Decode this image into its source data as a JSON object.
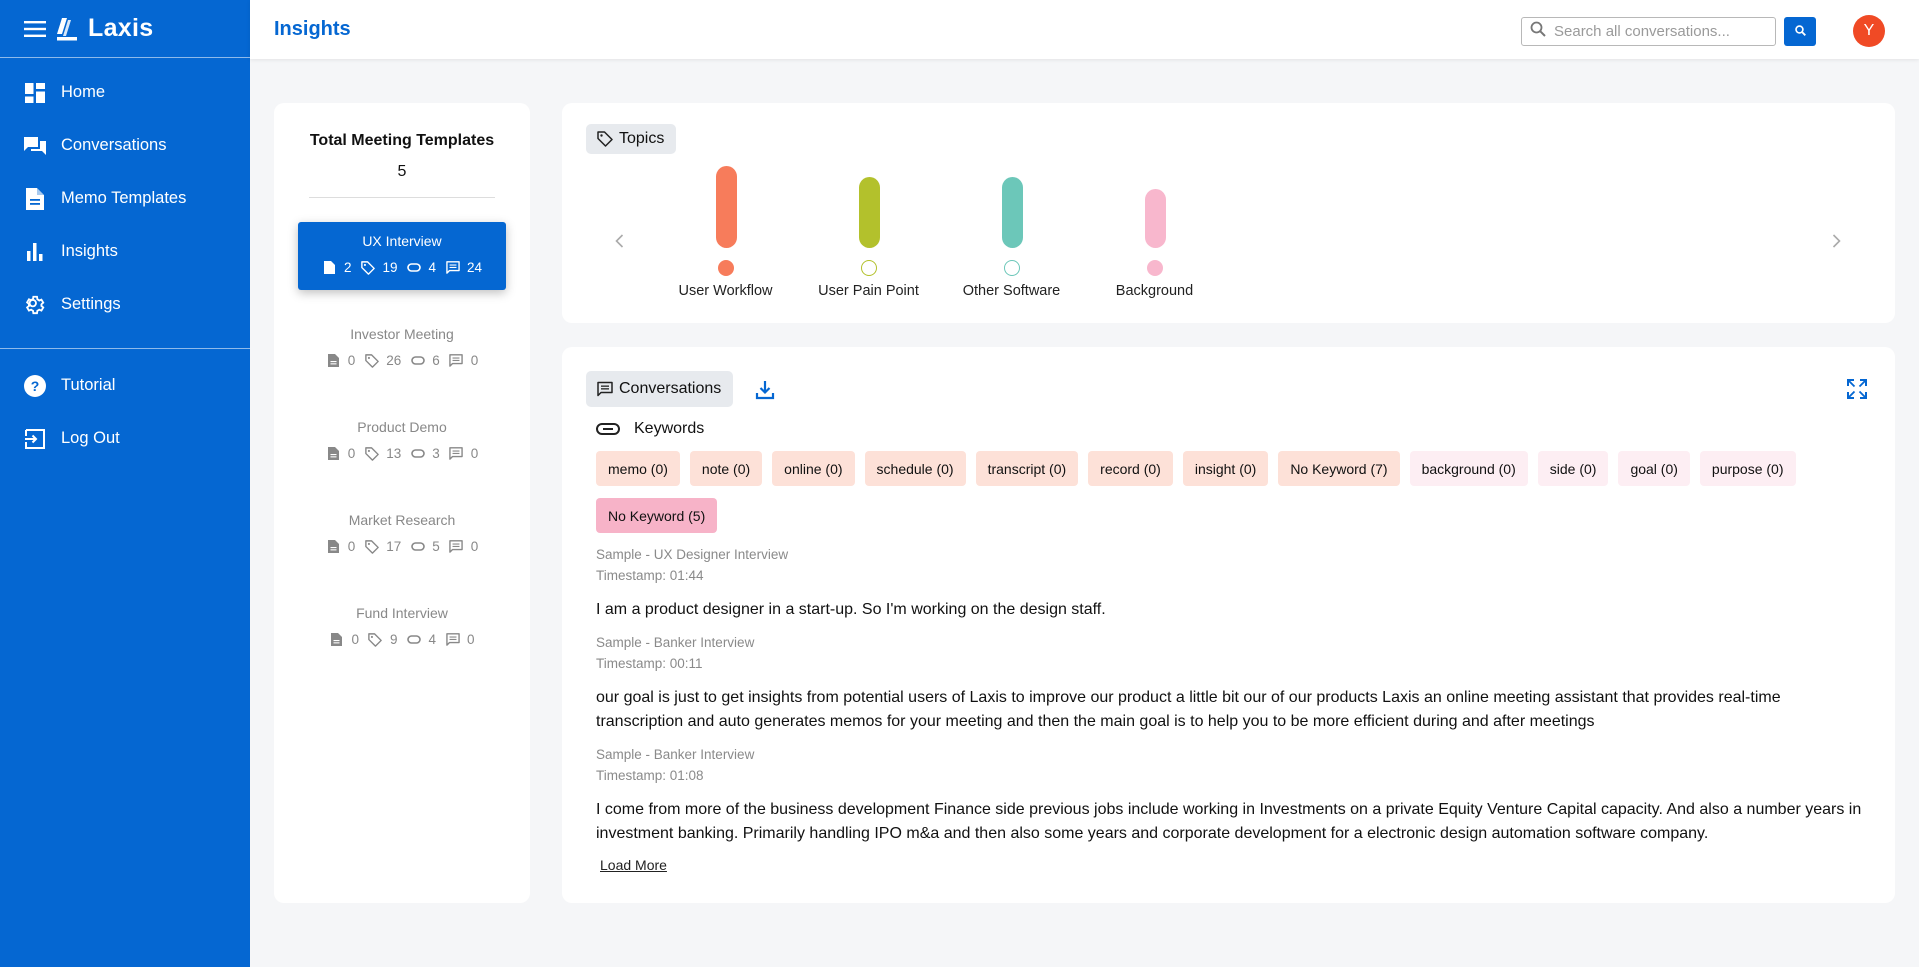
{
  "app": {
    "name": "Laxis",
    "page_title": "Insights"
  },
  "sidebar": {
    "items": [
      {
        "label": "Home",
        "icon": "dashboard-icon"
      },
      {
        "label": "Conversations",
        "icon": "chat-icon"
      },
      {
        "label": "Memo Templates",
        "icon": "document-icon"
      },
      {
        "label": "Insights",
        "icon": "bar-chart-icon"
      },
      {
        "label": "Settings",
        "icon": "gear-icon"
      }
    ],
    "bottom_items": [
      {
        "label": "Tutorial",
        "icon": "help-icon"
      },
      {
        "label": "Log Out",
        "icon": "logout-icon"
      }
    ]
  },
  "header": {
    "search_placeholder": "Search all conversations...",
    "avatar_letter": "Y"
  },
  "templates": {
    "heading": "Total Meeting Templates",
    "total": "5",
    "items": [
      {
        "name": "UX Interview",
        "memos": "2",
        "topics": "19",
        "keywords": "4",
        "conversations": "24",
        "active": true
      },
      {
        "name": "Investor Meeting",
        "memos": "0",
        "topics": "26",
        "keywords": "6",
        "conversations": "0",
        "active": false
      },
      {
        "name": "Product Demo",
        "memos": "0",
        "topics": "13",
        "keywords": "3",
        "conversations": "0",
        "active": false
      },
      {
        "name": "Market Research",
        "memos": "0",
        "topics": "17",
        "keywords": "5",
        "conversations": "0",
        "active": false
      },
      {
        "name": "Fund Interview",
        "memos": "0",
        "topics": "9",
        "keywords": "4",
        "conversations": "0",
        "active": false
      }
    ]
  },
  "topics": {
    "label": "Topics",
    "items": [
      {
        "label": "User Workflow",
        "color": "#f77c5b",
        "level": 1.0,
        "filled": true
      },
      {
        "label": "User Pain Point",
        "color": "#b3c12c",
        "level": 0.87,
        "filled": false
      },
      {
        "label": "Other Software",
        "color": "#6cc7b9",
        "level": 0.87,
        "filled": false
      },
      {
        "label": "Background",
        "color": "#f8b7cd",
        "level": 0.72,
        "filled": true
      }
    ]
  },
  "conversations": {
    "label": "Conversations",
    "keywords_label": "Keywords",
    "keywords": [
      {
        "text": "memo (0)",
        "color": "#fde1d8"
      },
      {
        "text": "note (0)",
        "color": "#fde1d8"
      },
      {
        "text": "online (0)",
        "color": "#fde1d8"
      },
      {
        "text": "schedule (0)",
        "color": "#fde1d8"
      },
      {
        "text": "transcript (0)",
        "color": "#fde1d8"
      },
      {
        "text": "record (0)",
        "color": "#fde1d8"
      },
      {
        "text": "insight (0)",
        "color": "#fde1d8"
      },
      {
        "text": "No Keyword (7)",
        "color": "#fde1d8"
      },
      {
        "text": "background (0)",
        "color": "#fdeef3"
      },
      {
        "text": "side (0)",
        "color": "#fdeef3"
      },
      {
        "text": "goal (0)",
        "color": "#fdeef3"
      },
      {
        "text": "purpose (0)",
        "color": "#fdeef3"
      },
      {
        "text": "No Keyword (5)",
        "color": "#f7b3c8"
      }
    ],
    "results": [
      {
        "source": "Sample - UX Designer Interview",
        "timestamp": "Timestamp: 01:44",
        "text": "I am a product designer in a start-up. So I'm working on the design staff."
      },
      {
        "source": "Sample - Banker Interview",
        "timestamp": "Timestamp: 00:11",
        "text": "our goal is just to get insights from potential users of Laxis to improve our product a little bit our of our products Laxis an online meeting assistant that provides real-time transcription and auto generates memos for your meeting and then the main goal is to help you to be more efficient during and after meetings"
      },
      {
        "source": "Sample - Banker Interview",
        "timestamp": "Timestamp: 01:08",
        "text": "I come from more of the business development Finance side previous jobs include working in Investments on a private Equity Venture Capital capacity. And also a number years in investment banking. Primarily handling IPO m&a and then also some years and corporate development for a electronic design automation software company."
      }
    ],
    "load_more": "Load More"
  }
}
